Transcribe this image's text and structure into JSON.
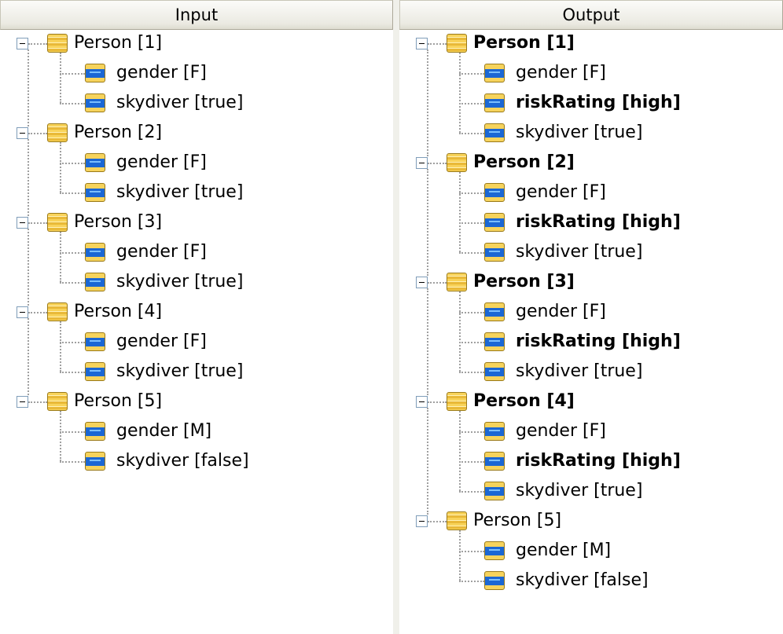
{
  "input": {
    "header": "Input",
    "persons": [
      {
        "label": "Person [1]",
        "attrs": [
          "gender [F]",
          "skydiver [true]"
        ]
      },
      {
        "label": "Person [2]",
        "attrs": [
          "gender [F]",
          "skydiver [true]"
        ]
      },
      {
        "label": "Person [3]",
        "attrs": [
          "gender [F]",
          "skydiver [true]"
        ]
      },
      {
        "label": "Person [4]",
        "attrs": [
          "gender [F]",
          "skydiver [true]"
        ]
      },
      {
        "label": "Person [5]",
        "attrs": [
          "gender [M]",
          "skydiver [false]"
        ]
      }
    ]
  },
  "output": {
    "header": "Output",
    "persons": [
      {
        "label": "Person [1]",
        "bold": true,
        "attrs": [
          {
            "text": "gender [F]",
            "bold": false
          },
          {
            "text": "riskRating [high]",
            "bold": true
          },
          {
            "text": "skydiver [true]",
            "bold": false
          }
        ]
      },
      {
        "label": "Person [2]",
        "bold": true,
        "attrs": [
          {
            "text": "gender [F]",
            "bold": false
          },
          {
            "text": "riskRating [high]",
            "bold": true
          },
          {
            "text": "skydiver [true]",
            "bold": false
          }
        ]
      },
      {
        "label": "Person [3]",
        "bold": true,
        "attrs": [
          {
            "text": "gender [F]",
            "bold": false
          },
          {
            "text": "riskRating [high]",
            "bold": true
          },
          {
            "text": "skydiver [true]",
            "bold": false
          }
        ]
      },
      {
        "label": "Person [4]",
        "bold": true,
        "attrs": [
          {
            "text": "gender [F]",
            "bold": false
          },
          {
            "text": "riskRating [high]",
            "bold": true
          },
          {
            "text": "skydiver [true]",
            "bold": false
          }
        ]
      },
      {
        "label": "Person [5]",
        "bold": false,
        "attrs": [
          {
            "text": "gender [M]",
            "bold": false
          },
          {
            "text": "skydiver [false]",
            "bold": false
          }
        ]
      }
    ]
  },
  "icons": {
    "object": "object-node-icon",
    "attribute": "attribute-node-icon",
    "expander": "collapse-minus-icon"
  },
  "colors": {
    "header_bg": "#ebeae2",
    "tree_lines": "#a0a0a0",
    "icon_yellow": "#f8d35a",
    "icon_blue": "#1b67d4"
  }
}
